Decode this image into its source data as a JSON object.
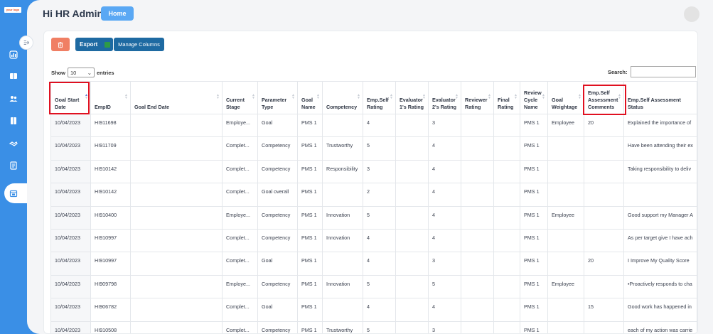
{
  "app": {
    "logo_text": "your logo"
  },
  "header": {
    "greeting": "Hi HR Admin",
    "home_label": "Home"
  },
  "toolbar": {
    "export_label": "Export",
    "manage_columns_label": "Manage Columns"
  },
  "entries": {
    "show_label": "Show",
    "value": "10",
    "suffix": "entries"
  },
  "search": {
    "label": "Search:",
    "value": ""
  },
  "table": {
    "columns": [
      "Goal Start Date",
      "EmpID",
      "Goal End Date",
      "Current Stage",
      "Parameter Type",
      "Goal Name",
      "Competency",
      "Emp.Self Rating",
      "Evaluator 1's Rating",
      "Evaluator 2's Rating",
      "Reviewer Rating",
      "Final Rating",
      "Review Cycle Name",
      "Goal Weightage",
      "Emp.Self Assessment Comments",
      "Emp.Self Assessment Status"
    ],
    "rows": [
      [
        "10/04/2023",
        "HI911698",
        "",
        "Employe...",
        "Goal",
        "PMS 1",
        "",
        "4",
        "",
        "3",
        "",
        "",
        "PMS 1",
        "Employee",
        "20",
        "Explained the importance of"
      ],
      [
        "10/04/2023",
        "HI911709",
        "",
        "Complet...",
        "Competency",
        "PMS 1",
        "Trustworthy",
        "5",
        "",
        "4",
        "",
        "",
        "PMS 1",
        "",
        "",
        "Have been attending their ex"
      ],
      [
        "10/04/2023",
        "HI910142",
        "",
        "Complet...",
        "Competency",
        "PMS 1",
        "Responsibility",
        "3",
        "",
        "4",
        "",
        "",
        "PMS 1",
        "",
        "",
        "Taking responsibility to deliv"
      ],
      [
        "10/04/2023",
        "HI910142",
        "",
        "Complet...",
        "Goal overall",
        "PMS 1",
        "",
        "2",
        "",
        "4",
        "",
        "",
        "PMS 1",
        "",
        "",
        ""
      ],
      [
        "10/04/2023",
        "HI910400",
        "",
        "Employe...",
        "Competency",
        "PMS 1",
        "Innovation",
        "5",
        "",
        "4",
        "",
        "",
        "PMS 1",
        "Employee",
        "",
        "Good support my Manager A"
      ],
      [
        "10/04/2023",
        "HI910997",
        "",
        "Complet...",
        "Competency",
        "PMS 1",
        "Innovation",
        "4",
        "",
        "4",
        "",
        "",
        "PMS 1",
        "",
        "",
        "As per target give I have ach"
      ],
      [
        "10/04/2023",
        "HI910997",
        "",
        "Complet...",
        "Goal",
        "PMS 1",
        "",
        "4",
        "",
        "3",
        "",
        "",
        "PMS 1",
        "",
        "20",
        "I Improve My Quality Score"
      ],
      [
        "10/04/2023",
        "HI909798",
        "",
        "Employe...",
        "Competency",
        "PMS 1",
        "Innovation",
        "5",
        "",
        "5",
        "",
        "",
        "PMS 1",
        "Employee",
        "",
        "•Proactively responds to cha"
      ],
      [
        "10/04/2023",
        "HI906782",
        "",
        "Complet...",
        "Goal",
        "PMS 1",
        "",
        "4",
        "",
        "4",
        "",
        "",
        "PMS 1",
        "",
        "15",
        "Good work has happened in"
      ],
      [
        "10/04/2023",
        "HI910508",
        "",
        "Complet...",
        "Competency",
        "PMS 1",
        "Trustworthy",
        "5",
        "",
        "3",
        "",
        "",
        "PMS 1",
        "",
        "",
        "each of my action was carrie"
      ]
    ]
  },
  "colors": {
    "sidebar": "#3a8fe6",
    "primary_button": "#1e6aa2",
    "delete_button": "#f07f64",
    "home_button": "#5aa8f4",
    "highlight": "#e01020"
  }
}
